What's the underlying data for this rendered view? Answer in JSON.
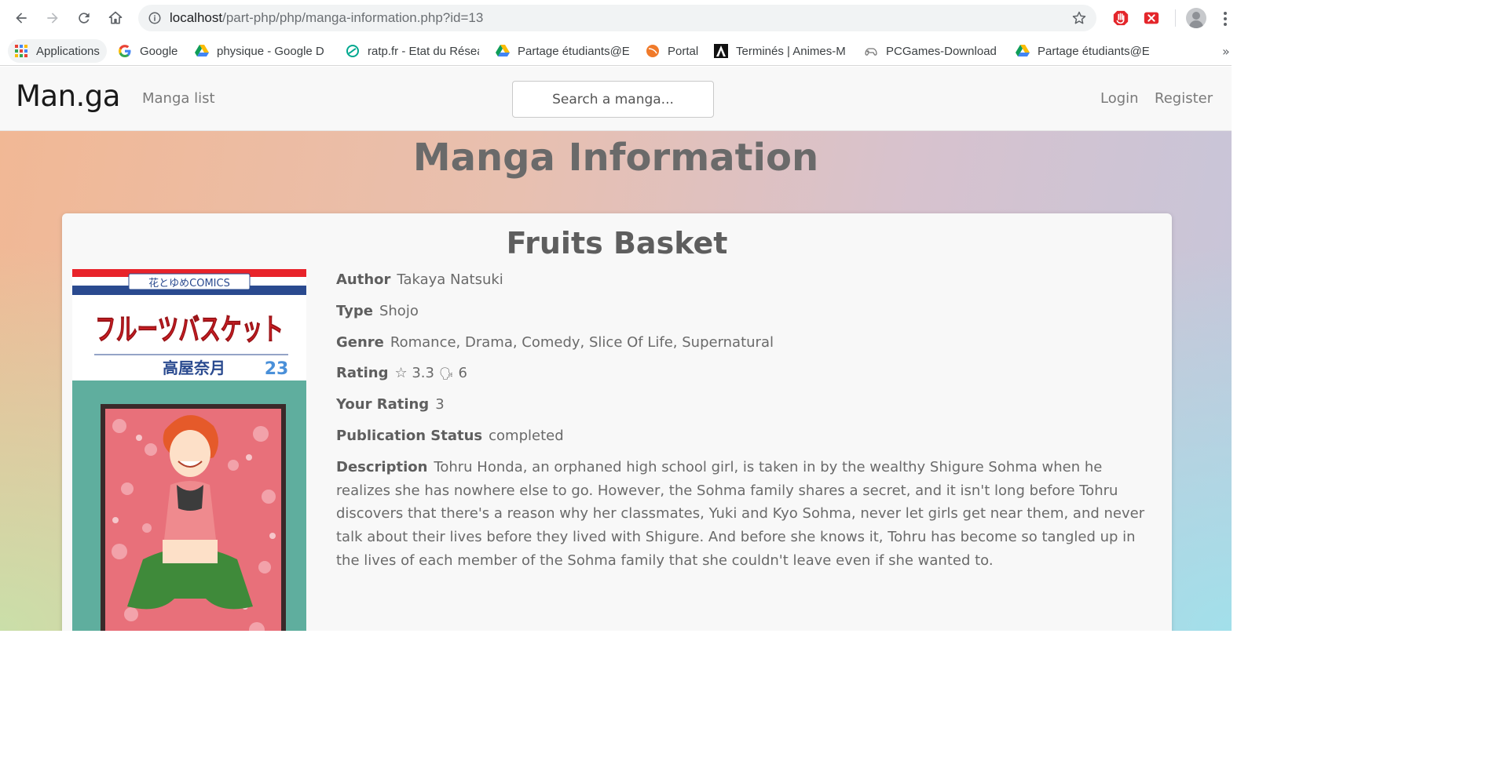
{
  "browser": {
    "url_host": "localhost",
    "url_path": "/part-php/php/manga-information.php?id=13",
    "bookmarks": [
      {
        "label": "Applications",
        "icon": "apps-grid-icon"
      },
      {
        "label": "Google",
        "icon": "google-icon"
      },
      {
        "label": "physique - Google D",
        "icon": "google-drive-icon"
      },
      {
        "label": "ratp.fr - Etat du Résea",
        "icon": "ratp-icon"
      },
      {
        "label": "Partage étudiants@E",
        "icon": "google-drive-icon"
      },
      {
        "label": "Portal",
        "icon": "portal-icon"
      },
      {
        "label": "Terminés | Animes-M",
        "icon": "anime-icon"
      },
      {
        "label": "PCGames-Download",
        "icon": "gamepad-icon"
      },
      {
        "label": "Partage étudiants@E",
        "icon": "google-drive-icon"
      }
    ],
    "more": "»"
  },
  "site": {
    "brand": "Man.ga",
    "manga_list": "Manga list",
    "search_placeholder": "Search a manga...",
    "login": "Login",
    "register": "Register"
  },
  "page": {
    "title": "Manga Information"
  },
  "manga": {
    "title": "Fruits Basket",
    "author_label": "Author",
    "author": "Takaya Natsuki",
    "type_label": "Type",
    "type": "Shojo",
    "genre_label": "Genre",
    "genre": "Romance, Drama, Comedy, Slice Of Life, Supernatural",
    "rating_label": "Rating",
    "rating_star": "☆",
    "rating_value": "3.3",
    "votes_icon": "🗣",
    "votes": "6",
    "your_rating_label": "Your Rating",
    "your_rating": "3",
    "status_label": "Publication Status",
    "status": "completed",
    "description_label": "Description",
    "description": "Tohru Honda, an orphaned high school girl, is taken in by the wealthy Shigure Sohma when he realizes she has nowhere else to go. However, the Sohma family shares a secret, and it isn't long before Tohru discovers that there's a reason why her classmates, Yuki and Kyo Sohma, never let girls get near them, and never talk about their lives before they lived with Shigure. And before she knows it, Tohru has become so tangled up in the lives of each member of the Sohma family that she couldn't leave even if she wanted to.",
    "cover": {
      "imprint": "花とゆめCOMICS",
      "jp_title": "フルーツバスケット",
      "jp_author": "高屋奈月",
      "volume": "23"
    }
  },
  "colors": {
    "accent_red": "#e8232a",
    "cover_teal": "#5fae9e",
    "cover_blue": "#2a4a8f"
  }
}
